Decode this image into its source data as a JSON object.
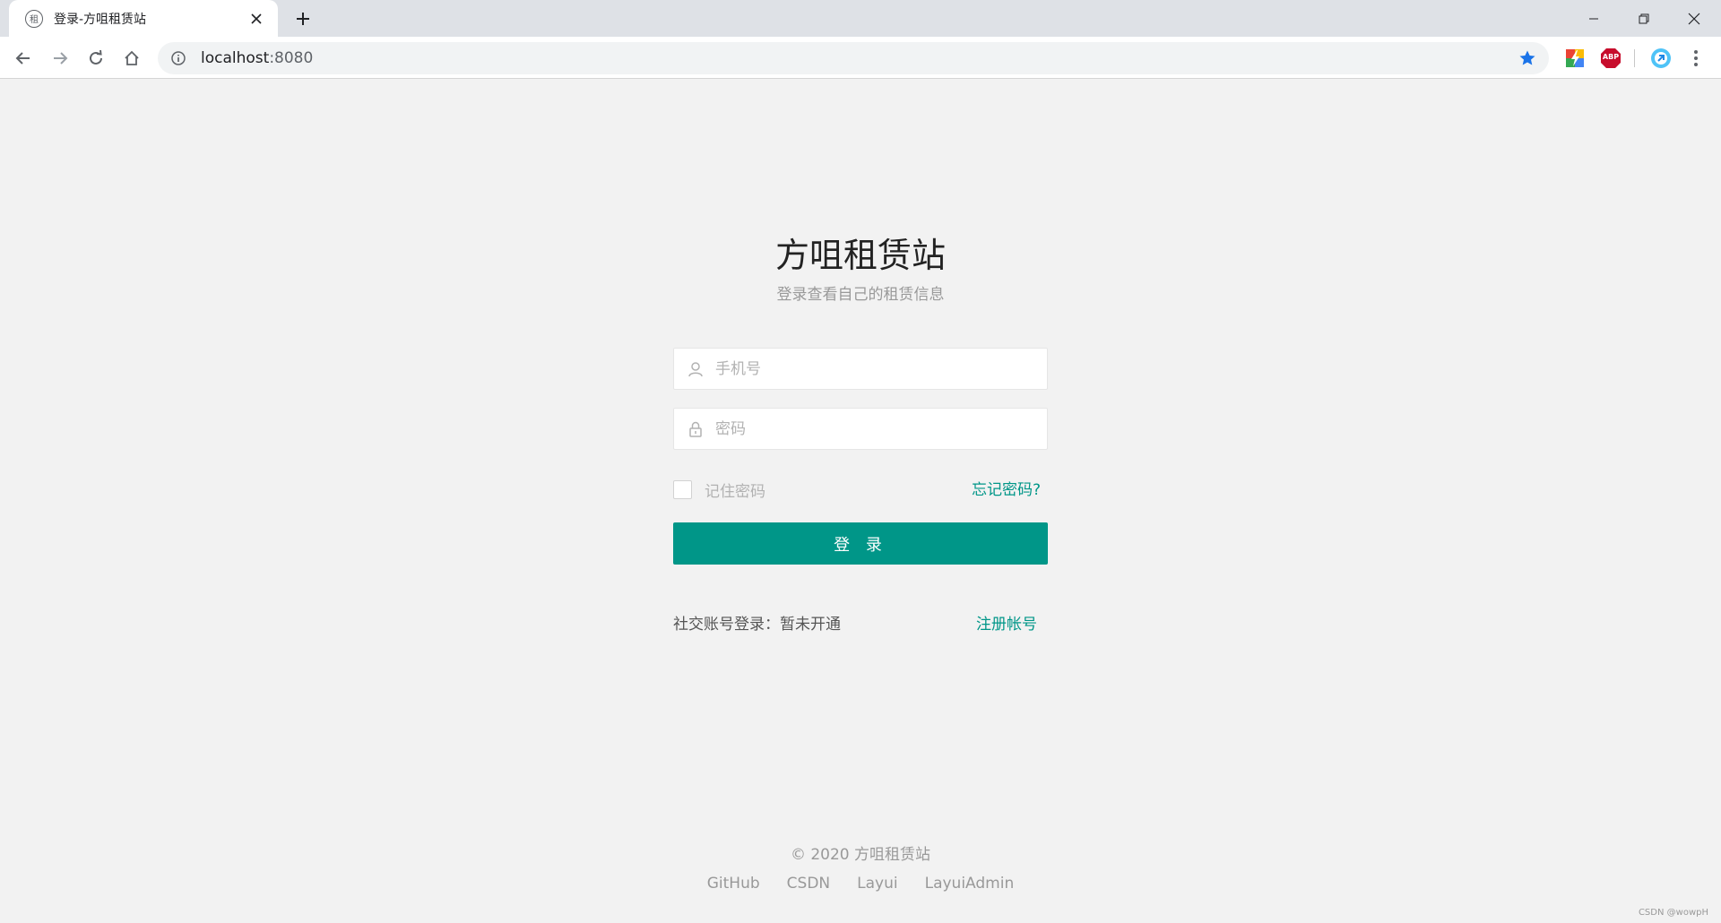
{
  "browser": {
    "tab": {
      "favicon_char": "租",
      "title": "登录-方咀租赁站"
    },
    "address": {
      "host": "localhost",
      "port": ":8080"
    },
    "extensions": {
      "abp_label": "ABP"
    }
  },
  "header": {
    "title": "方咀租赁站",
    "subtitle": "登录查看自己的租赁信息"
  },
  "form": {
    "phone_placeholder": "手机号",
    "password_placeholder": "密码",
    "remember_label": "记住密码",
    "forgot_label": "忘记密码?",
    "login_label": "登 录",
    "social_text": "社交账号登录：暂未开通",
    "register_label": "注册帐号"
  },
  "footer": {
    "copyright": "© 2020  方咀租赁站",
    "links": [
      "GitHub",
      "CSDN",
      "Layui",
      "LayuiAdmin"
    ]
  },
  "watermark": "CSDN @wowpH",
  "colors": {
    "accent": "#009688",
    "background": "#f2f2f2"
  }
}
